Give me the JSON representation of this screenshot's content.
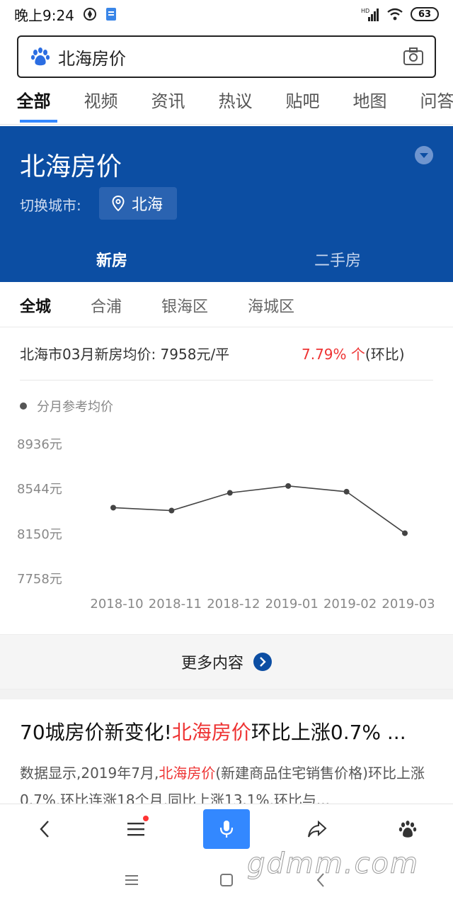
{
  "status": {
    "time": "晚上9:24",
    "signal": "HD",
    "battery": "63"
  },
  "search": {
    "query": "北海房价"
  },
  "tabs": [
    "全部",
    "视频",
    "资讯",
    "热议",
    "贴吧",
    "地图",
    "问答"
  ],
  "panel": {
    "title": "北海房价",
    "city_label": "切换城市:",
    "city": "北海",
    "sub_tabs": {
      "new": "新房",
      "second": "二手房"
    }
  },
  "districts": [
    "全城",
    "合浦",
    "银海区",
    "海城区"
  ],
  "average": {
    "text": "北海市03月新房均价: 7958元/平",
    "change": "7.79% 个",
    "change_suffix": "(环比)"
  },
  "legend": {
    "label": "分月参考均价"
  },
  "chart_data": {
    "type": "line",
    "title": "",
    "xlabel": "",
    "ylabel": "",
    "categories": [
      "2018-10",
      "2018-11",
      "2018-12",
      "2019-01",
      "2019-02",
      "2019-03"
    ],
    "values": [
      8375,
      8350,
      8505,
      8565,
      8515,
      8152
    ],
    "y_ticks": [
      "8936元",
      "8544元",
      "8150元",
      "7758元"
    ],
    "y_tick_values": [
      8936,
      8544,
      8150,
      7758
    ],
    "ylim": [
      7758,
      8936
    ],
    "grid": false,
    "line_color": "#444444"
  },
  "more": {
    "label": "更多内容"
  },
  "article": {
    "title_pre": "70城房价新变化!",
    "title_hl": "北海房价",
    "title_post": "环比上涨0.7% ...",
    "desc_pre": "数据显示,2019年7月,",
    "desc_hl": "北海房价",
    "desc_post": "(新建商品住宅销售价格)环比上涨0.7%,环比连涨18个月,同比上涨13.1%,环比与..."
  },
  "watermark": "gdmm.com",
  "colors": {
    "panel_bg": "#0c4ea3",
    "accent": "#3388ff",
    "highlight": "#e33333"
  }
}
